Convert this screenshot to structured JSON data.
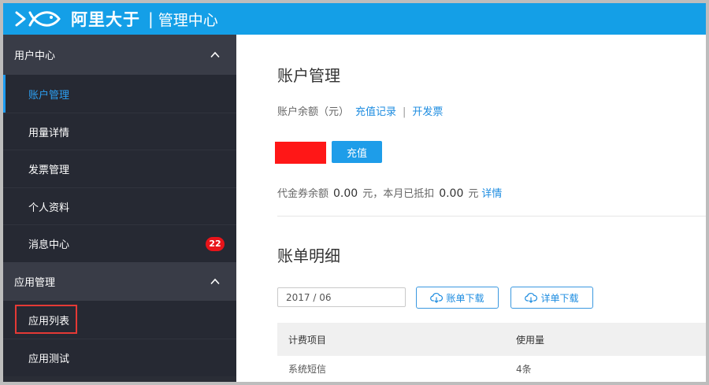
{
  "header": {
    "logo_icon": "fish-logo-icon",
    "brand": "阿里大于",
    "divider": "|",
    "subtitle": "管理中心"
  },
  "sidebar": {
    "sections": [
      {
        "title": "用户中心",
        "icon": "chevron-up-icon",
        "items": [
          {
            "label": "账户管理",
            "active": true
          },
          {
            "label": "用量详情"
          },
          {
            "label": "发票管理"
          },
          {
            "label": "个人资料"
          },
          {
            "label": "消息中心",
            "badge": "22"
          }
        ]
      },
      {
        "title": "应用管理",
        "icon": "chevron-up-icon",
        "items": [
          {
            "label": "应用列表",
            "highlighted": true
          },
          {
            "label": "应用测试"
          }
        ]
      }
    ]
  },
  "account": {
    "title": "账户管理",
    "balance_label": "账户余额（元）",
    "recharge_record_link": "充值记录",
    "separator": "|",
    "invoice_link": "开发票",
    "recharge_button": "充值",
    "voucher_label": "代金券余额",
    "voucher_amount": "0.00",
    "voucher_mid": "元，本月已抵扣",
    "deducted_amount": "0.00",
    "deducted_unit": "元",
    "details_link": "详情"
  },
  "billing": {
    "title": "账单明细",
    "month_value": "2017 / 06",
    "bill_download_button": "账单下载",
    "detail_download_button": "详单下载",
    "download_icon": "cloud-download-icon",
    "table": {
      "columns": [
        "计费项目",
        "使用量"
      ],
      "rows": [
        [
          "系统短信",
          "4条"
        ]
      ]
    }
  },
  "colors": {
    "header_bg": "#149fe7",
    "accent": "#1d8ce0",
    "sidebar_section_bg": "#393c47",
    "sidebar_item_bg": "#262933",
    "badge": "#e8141a",
    "annotation": "#e53935",
    "redaction": "#ff1717"
  }
}
